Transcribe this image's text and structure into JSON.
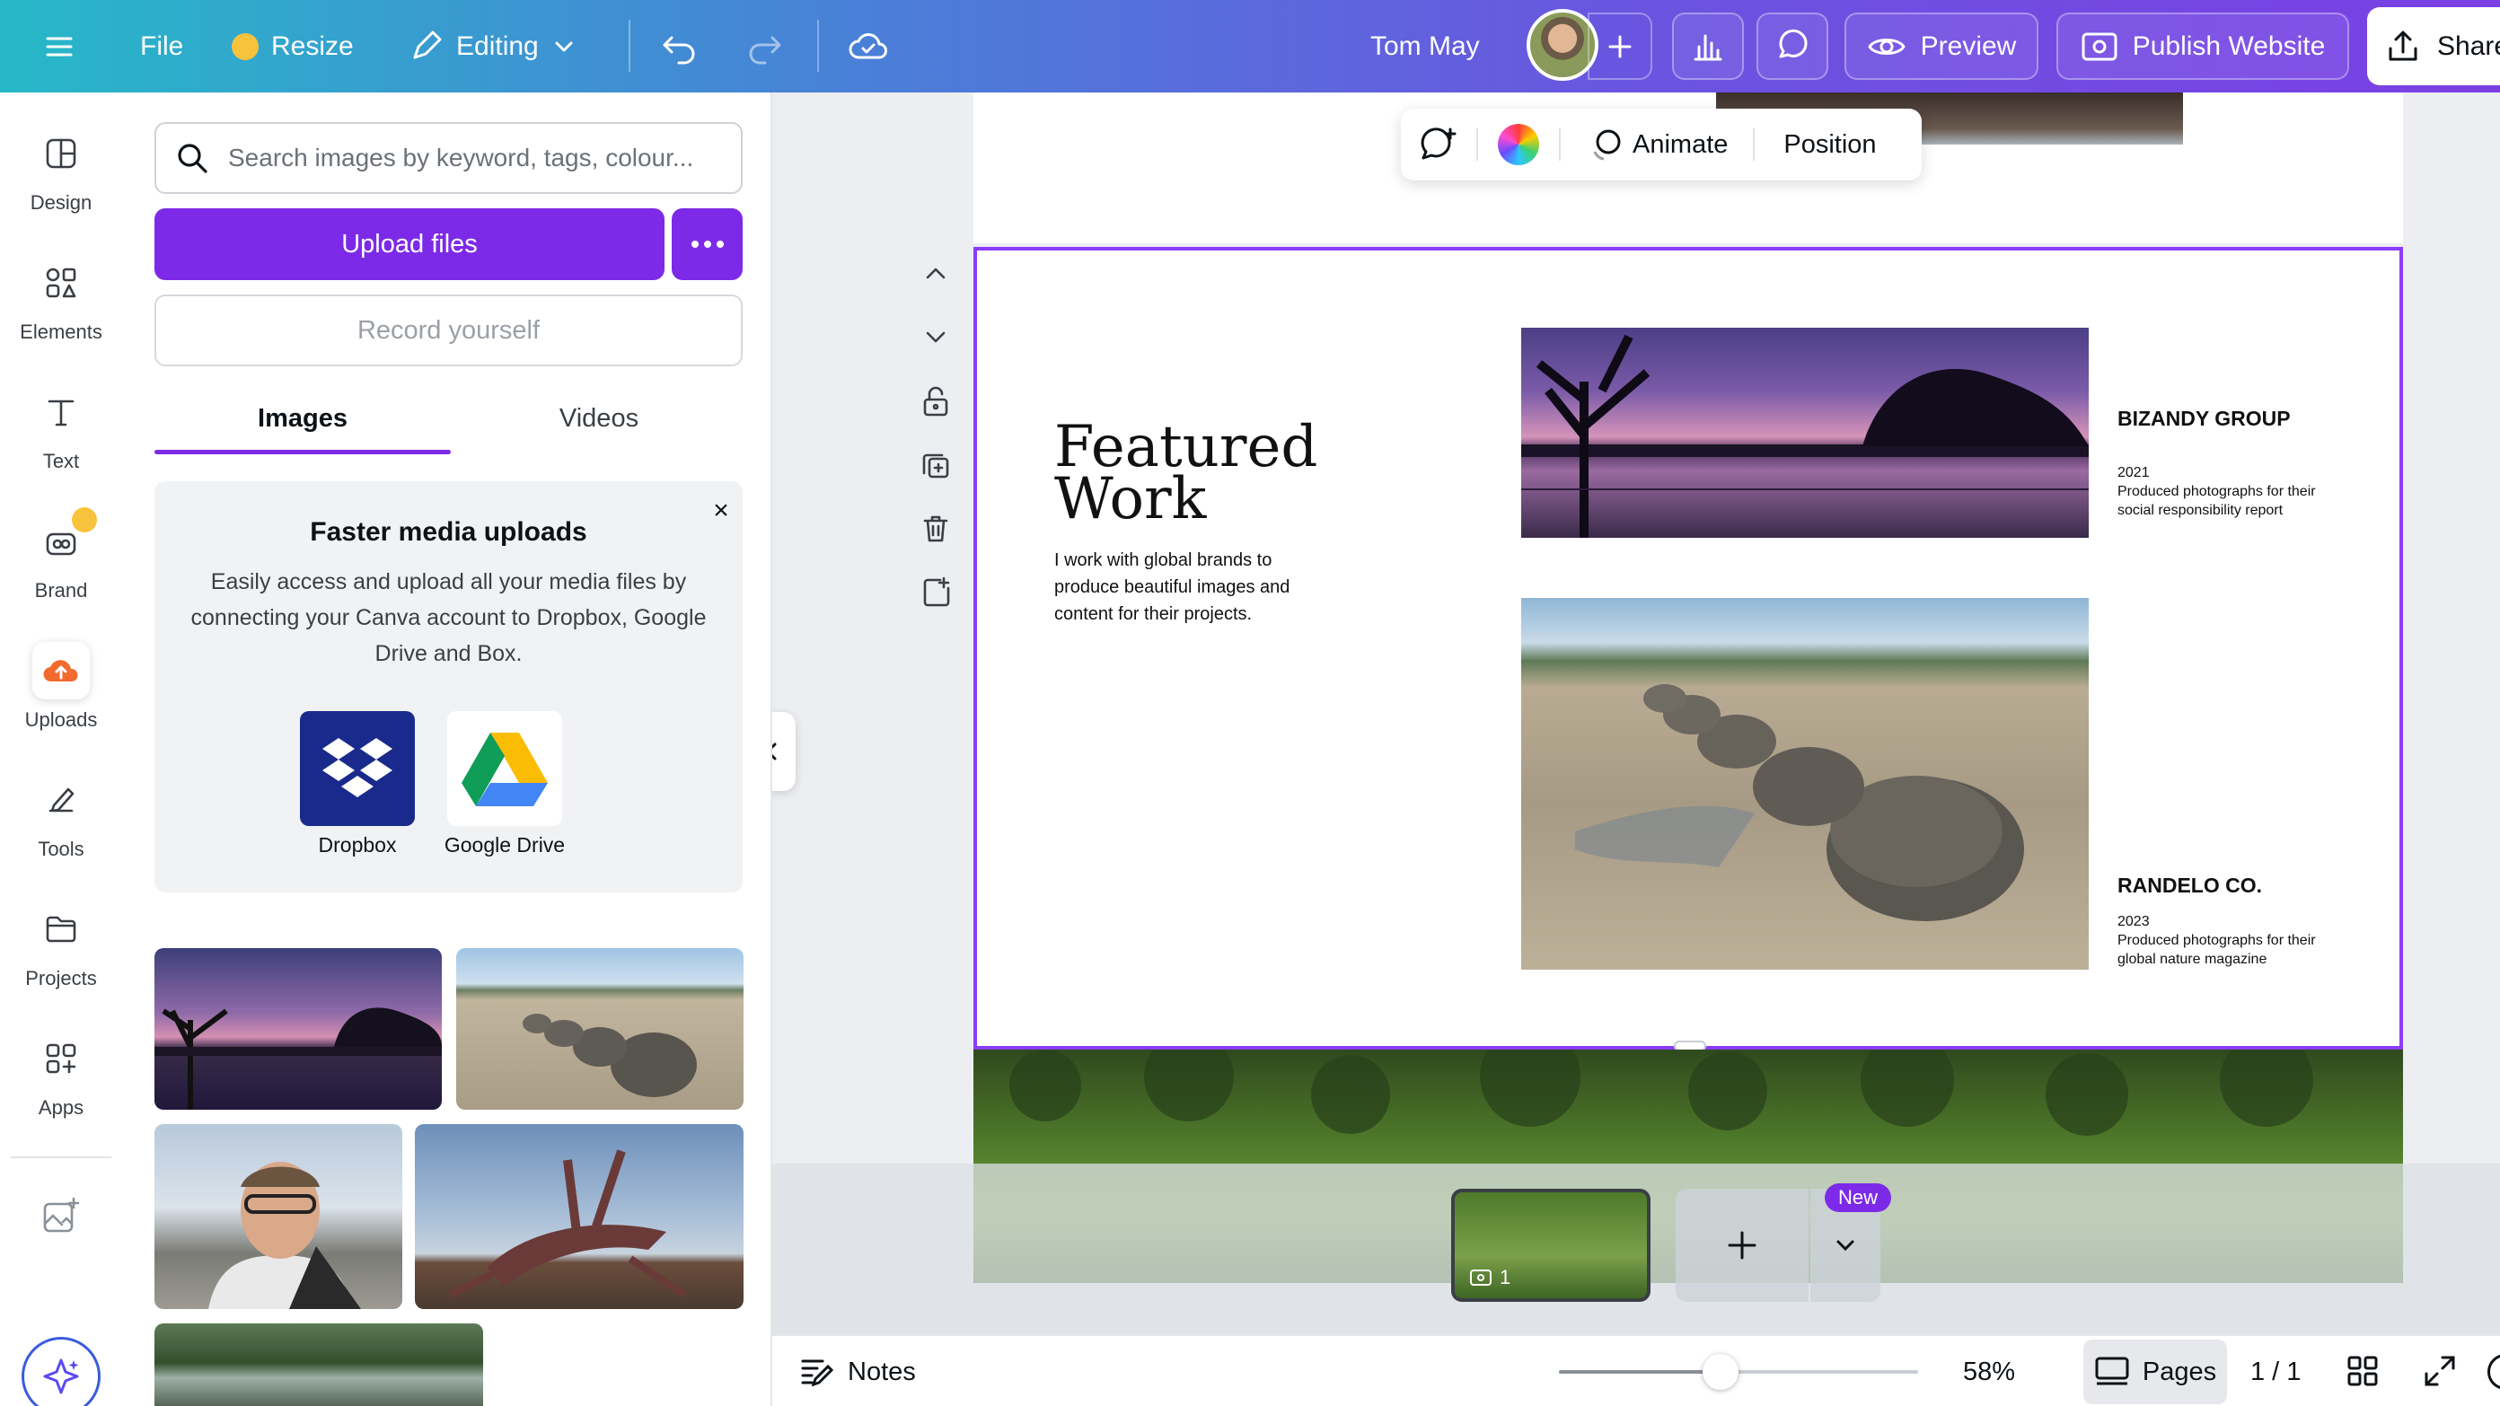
{
  "topbar": {
    "file_label": "File",
    "resize_label": "Resize",
    "editing_label": "Editing",
    "user_name": "Tom May",
    "preview_label": "Preview",
    "publish_label": "Publish Website",
    "share_label": "Share"
  },
  "rail": {
    "items": [
      {
        "label": "Design",
        "icon": "design-icon"
      },
      {
        "label": "Elements",
        "icon": "elements-icon"
      },
      {
        "label": "Text",
        "icon": "text-icon"
      },
      {
        "label": "Brand",
        "icon": "brand-icon"
      },
      {
        "label": "Uploads",
        "icon": "uploads-icon"
      },
      {
        "label": "Tools",
        "icon": "tools-icon"
      },
      {
        "label": "Projects",
        "icon": "projects-icon"
      },
      {
        "label": "Apps",
        "icon": "apps-icon"
      }
    ]
  },
  "panel": {
    "search_placeholder": "Search images by keyword, tags, colour...",
    "upload_label": "Upload files",
    "record_label": "Record yourself",
    "tabs": [
      "Images",
      "Videos"
    ],
    "info_title": "Faster media uploads",
    "info_body": "Easily access and upload all your media files by connecting your Canva account to Dropbox, Google Drive and Box.",
    "providers": [
      "Dropbox",
      "Google Drive"
    ]
  },
  "context_toolbar": {
    "animate_label": "Animate",
    "position_label": "Position"
  },
  "design": {
    "title_line1": "Featured",
    "title_line2": "Work",
    "description": "I work with global brands to produce beautiful images and content for their projects.",
    "clients": [
      {
        "name": "BIZANDY GROUP",
        "year": "2021",
        "desc": "Produced photographs for their social responsibility report"
      },
      {
        "name": "RANDELO CO.",
        "year": "2023",
        "desc": "Produced photographs for their global nature magazine"
      }
    ]
  },
  "pages": {
    "thumb_page_number": "1",
    "new_badge": "New"
  },
  "status": {
    "notes_label": "Notes",
    "zoom": "58%",
    "zoom_fraction": 0.58,
    "pages_label": "Pages",
    "page_count": "1 / 1"
  },
  "colors": {
    "accent": "#7d2ae8",
    "selection": "#8b3dff"
  }
}
